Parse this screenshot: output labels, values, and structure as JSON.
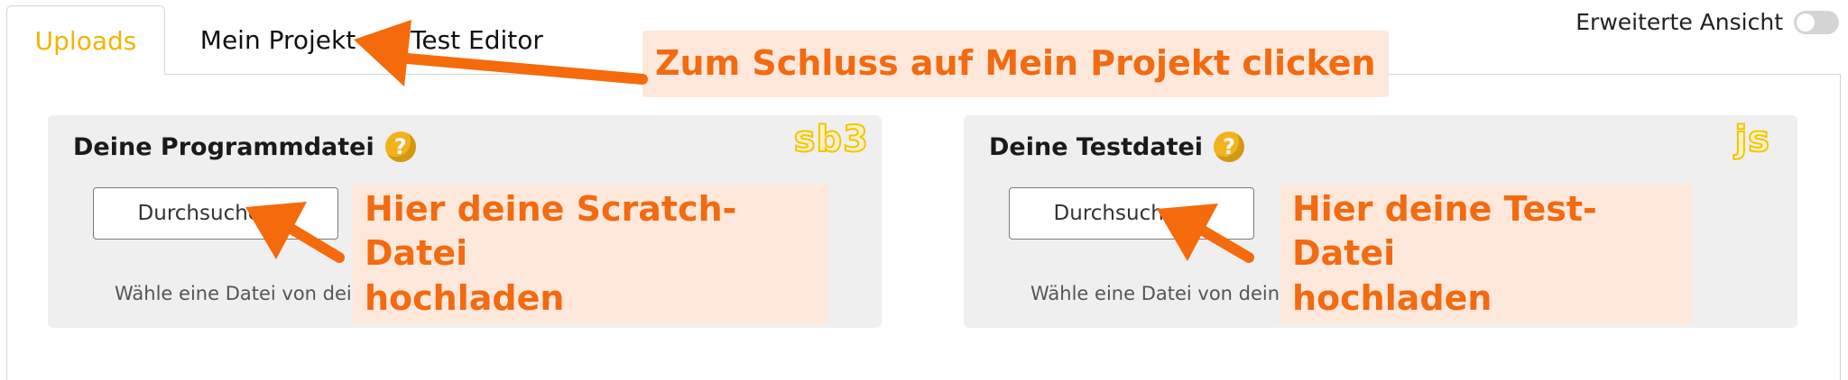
{
  "tabs": [
    {
      "label": "Uploads",
      "active": true
    },
    {
      "label": "Mein Projekt",
      "active": false
    },
    {
      "label": "Test Editor",
      "active": false
    }
  ],
  "toggle": {
    "label": "Erweiterte Ansicht",
    "on": false
  },
  "cards": [
    {
      "title": "Deine Programmdatei",
      "help_icon": "question-icon",
      "file_type_badge": "sb3",
      "browse_label": "Durchsuchen...",
      "hint": "Wähle eine Datei von deiner Festplatte aus."
    },
    {
      "title": "Deine Testdatei",
      "help_icon": "question-icon",
      "file_type_badge": "js",
      "browse_label": "Durchsuchen...",
      "hint": "Wähle eine Datei von deiner Festplatte aus."
    }
  ],
  "annotations": {
    "top": "Zum Schluss auf Mein Projekt clicken",
    "left": [
      "Hier deine Scratch-Datei",
      "hochladen"
    ],
    "right": [
      "Hier deine Test-Datei",
      "hochladen"
    ]
  },
  "colors": {
    "accent": "#f4b400",
    "annotation_text": "#f36a10",
    "annotation_bg": "#fde8db",
    "arrow": "#f56a0a",
    "card_bg": "#efefef"
  }
}
